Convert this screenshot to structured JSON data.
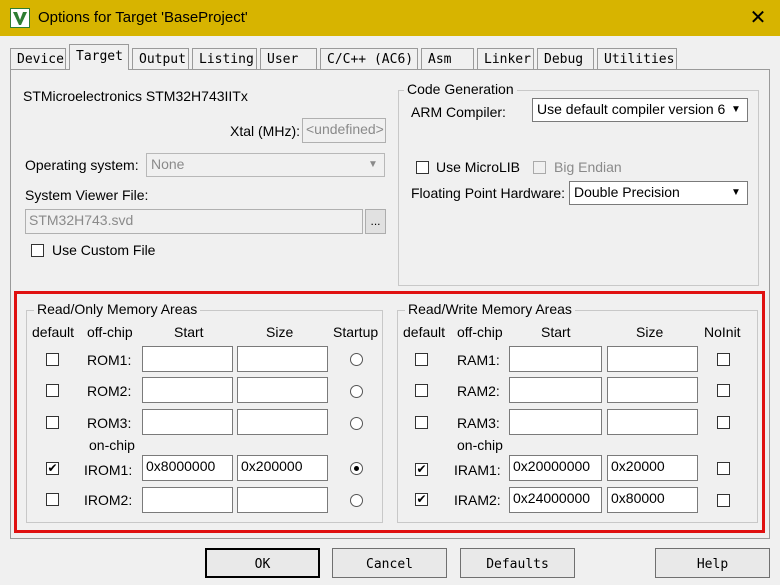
{
  "window": {
    "title": "Options for Target 'BaseProject'",
    "close": "✕"
  },
  "tabs": [
    "Device",
    "Target",
    "Output",
    "Listing",
    "User",
    "C/C++ (AC6)",
    "Asm",
    "Linker",
    "Debug",
    "Utilities"
  ],
  "active_tab": "Target",
  "target": {
    "device_name": "STMicroelectronics STM32H743IITx",
    "xtal_label": "Xtal (MHz):",
    "xtal_value": "<undefined>",
    "os_label": "Operating system:",
    "os_value": "None",
    "svd_label": "System Viewer File:",
    "svd_value": "STM32H743.svd",
    "browse_label": "...",
    "use_custom_file": "Use Custom File"
  },
  "code_generation": {
    "legend": "Code Generation",
    "compiler_label": "ARM Compiler:",
    "compiler_value": "Use default compiler version 6",
    "use_microlib": "Use MicroLIB",
    "big_endian": "Big Endian",
    "fph_label": "Floating Point Hardware:",
    "fph_value": "Double Precision"
  },
  "rom_areas": {
    "legend": "Read/Only Memory Areas",
    "headers": {
      "default": "default",
      "offchip": "off-chip",
      "start": "Start",
      "size": "Size",
      "startup": "Startup"
    },
    "onchip_label": "on-chip",
    "rows": [
      {
        "name": "ROM1:",
        "default": false,
        "start": "",
        "size": "",
        "startup": false
      },
      {
        "name": "ROM2:",
        "default": false,
        "start": "",
        "size": "",
        "startup": false
      },
      {
        "name": "ROM3:",
        "default": false,
        "start": "",
        "size": "",
        "startup": false
      },
      {
        "name": "IROM1:",
        "default": true,
        "start": "0x8000000",
        "size": "0x200000",
        "startup": true
      },
      {
        "name": "IROM2:",
        "default": false,
        "start": "",
        "size": "",
        "startup": false
      }
    ]
  },
  "ram_areas": {
    "legend": "Read/Write Memory Areas",
    "headers": {
      "default": "default",
      "offchip": "off-chip",
      "start": "Start",
      "size": "Size",
      "noinit": "NoInit"
    },
    "onchip_label": "on-chip",
    "rows": [
      {
        "name": "RAM1:",
        "default": false,
        "start": "",
        "size": "",
        "noinit": false
      },
      {
        "name": "RAM2:",
        "default": false,
        "start": "",
        "size": "",
        "noinit": false
      },
      {
        "name": "RAM3:",
        "default": false,
        "start": "",
        "size": "",
        "noinit": false
      },
      {
        "name": "IRAM1:",
        "default": true,
        "start": "0x20000000",
        "size": "0x20000",
        "noinit": false
      },
      {
        "name": "IRAM2:",
        "default": true,
        "start": "0x24000000",
        "size": "0x80000",
        "noinit": false
      }
    ]
  },
  "buttons": {
    "ok": "OK",
    "cancel": "Cancel",
    "defaults": "Defaults",
    "help": "Help"
  },
  "checkmark": "✔",
  "colors": {
    "titlebar": "#d7b400",
    "highlight": "#e01010"
  }
}
